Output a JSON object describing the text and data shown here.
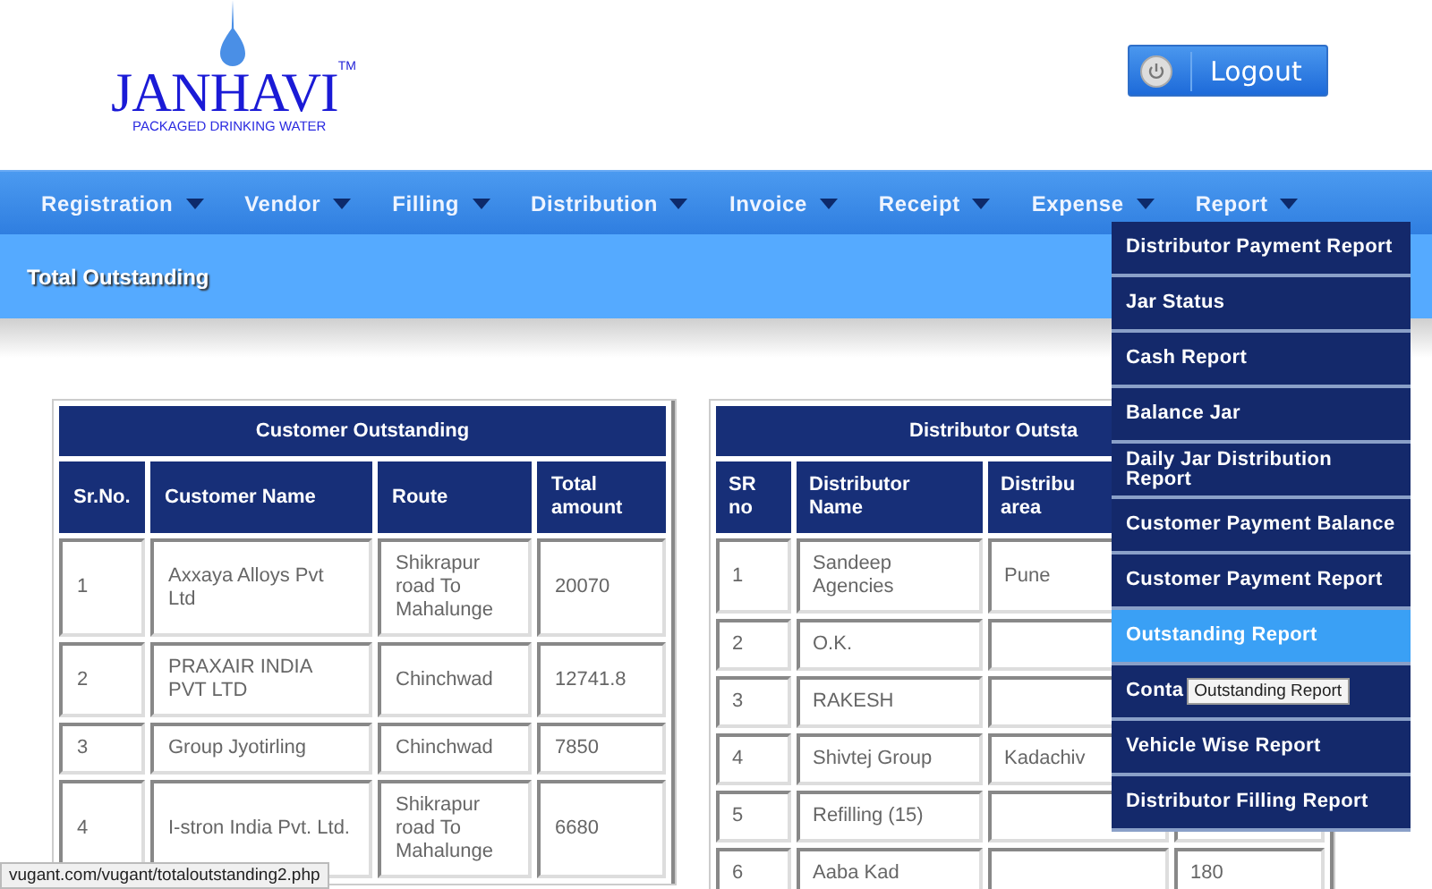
{
  "logo": {
    "name": "JANHAVI",
    "trademark": "TM",
    "tagline": "PACKAGED DRINKING WATER"
  },
  "logout": {
    "label": "Logout"
  },
  "nav": [
    {
      "label": "Registration"
    },
    {
      "label": "Vendor"
    },
    {
      "label": "Filling"
    },
    {
      "label": "Distribution"
    },
    {
      "label": "Invoice"
    },
    {
      "label": "Receipt"
    },
    {
      "label": "Expense"
    },
    {
      "label": "Report"
    }
  ],
  "page_title": "Total Outstanding",
  "report_menu": [
    {
      "label": "Distributor Payment Report",
      "selected": false
    },
    {
      "label": "Jar Status",
      "selected": false
    },
    {
      "label": "Cash Report",
      "selected": false
    },
    {
      "label": "Balance Jar",
      "selected": false
    },
    {
      "label": "Daily Jar Distribution Report",
      "selected": false
    },
    {
      "label": "Customer Payment Balance",
      "selected": false
    },
    {
      "label": "Customer Payment Report",
      "selected": false
    },
    {
      "label": "Outstanding Report",
      "selected": true
    },
    {
      "label": "Conta",
      "selected": false
    },
    {
      "label": "Vehicle Wise Report",
      "selected": false
    },
    {
      "label": "Distributor Filling Report",
      "selected": false
    }
  ],
  "tooltip": "Outstanding Report",
  "customer_table": {
    "title": "Customer Outstanding",
    "columns": [
      "Sr.No.",
      "Customer Name",
      "Route",
      "Total amount"
    ],
    "rows": [
      [
        "1",
        "Axxaya Alloys Pvt Ltd",
        "Shikrapur road To Mahalunge",
        "20070"
      ],
      [
        "2",
        "PRAXAIR INDIA PVT LTD",
        "Chinchwad",
        "12741.8"
      ],
      [
        "3",
        "Group Jyotirling",
        "Chinchwad",
        "7850"
      ],
      [
        "4",
        "I-stron India Pvt. Ltd.",
        "Shikrapur road To Mahalunge",
        "6680"
      ]
    ]
  },
  "distributor_table": {
    "title": "Distributor Outsta",
    "columns": [
      "SR no",
      "Distributor Name",
      "Distribu area",
      null
    ],
    "rows": [
      [
        "1",
        "Sandeep Agencies",
        "Pune",
        null
      ],
      [
        "2",
        "O.K.",
        null,
        null
      ],
      [
        "3",
        "RAKESH",
        null,
        null
      ],
      [
        "4",
        "Shivtej Group",
        "Kadachiv",
        null
      ],
      [
        "5",
        "Refilling (15)",
        null,
        null
      ],
      [
        "6",
        "Aaba Kad",
        null,
        "180"
      ]
    ]
  },
  "status_url": "vugant.com/vugant/totaloutstanding2.php"
}
